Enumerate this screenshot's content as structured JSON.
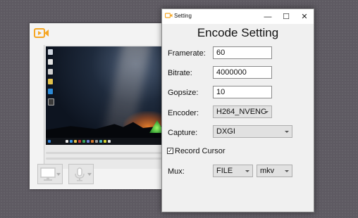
{
  "main_window": {
    "colors": {
      "accent": "#f5a623"
    }
  },
  "dialog": {
    "title": "Setting",
    "controls": {
      "minimize": "—",
      "maximize": "☐",
      "close": "✕"
    },
    "heading": "Encode Setting",
    "fields": {
      "framerate": {
        "label": "Framerate:",
        "value": "60"
      },
      "bitrate": {
        "label": "Bitrate:",
        "value": "4000000"
      },
      "gopsize": {
        "label": "Gopsize:",
        "value": "10"
      }
    },
    "encoder": {
      "label": "Encoder:",
      "selected": "H264_NVENC"
    },
    "capture": {
      "label": "Capture:",
      "selected": "DXGI"
    },
    "record_cursor": {
      "label": "Record Cursor",
      "checked": true,
      "check_glyph": "✓"
    },
    "mux": {
      "label": "Mux:",
      "format": "FILE",
      "container": "mkv"
    }
  }
}
